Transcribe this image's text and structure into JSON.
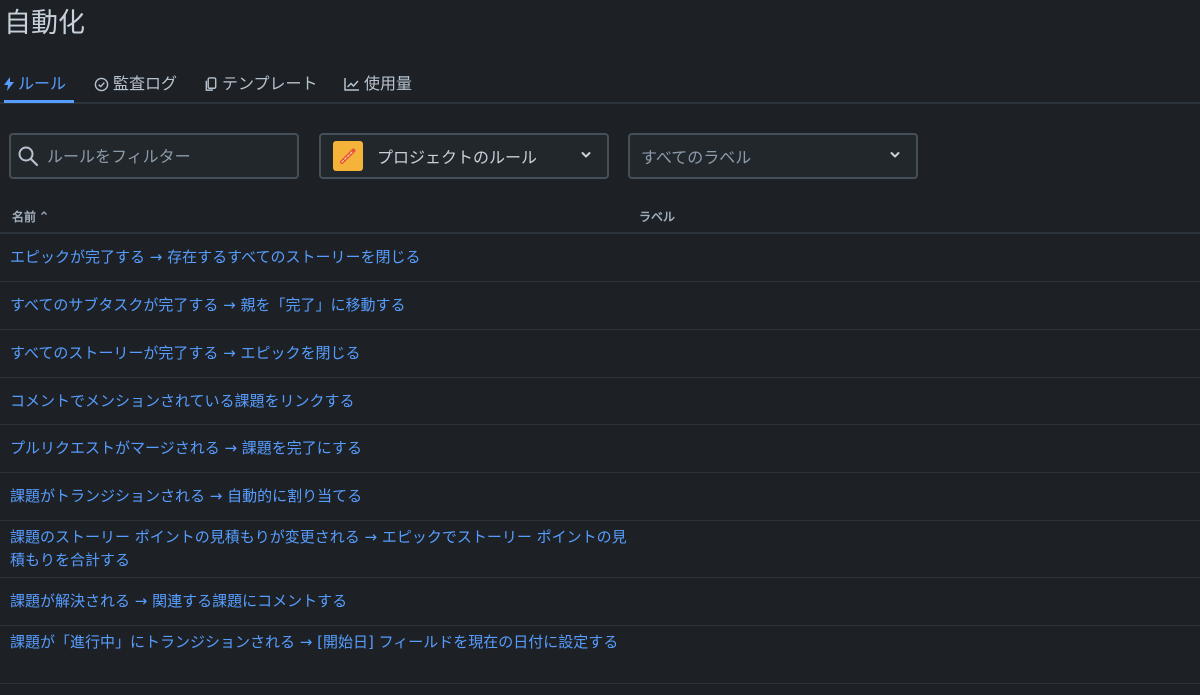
{
  "page": {
    "title": "自動化"
  },
  "tabs": [
    {
      "label": "ルール",
      "icon": "lightning-icon",
      "active": true
    },
    {
      "label": "監査ログ",
      "icon": "check-circle-icon",
      "active": false
    },
    {
      "label": "テンプレート",
      "icon": "copy-icon",
      "active": false
    },
    {
      "label": "使用量",
      "icon": "chart-icon",
      "active": false
    }
  ],
  "filters": {
    "search_placeholder": "ルールをフィルター",
    "project_select": "プロジェクトのルール",
    "label_select": "すべてのラベル"
  },
  "table": {
    "columns": {
      "name": "名前",
      "label": "ラベル"
    },
    "rows": [
      "エピックが完了する → 存在するすべてのストーリーを閉じる",
      "すべてのサブタスクが完了する → 親を「完了」に移動する",
      "すべてのストーリーが完了する → エピックを閉じる",
      "コメントでメンションされている課題をリンクする",
      "プルリクエストがマージされる → 課題を完了にする",
      "課題がトランジションされる → 自動的に割り当てる",
      "課題のストーリー ポイントの見積もりが変更される → エピックでストーリー ポイントの見積もりを合計する",
      "課題が解決される → 関連する課題にコメントする",
      "課題が「進行中」にトランジションされる → [開始日] フィールドを現在の日付に設定する"
    ]
  },
  "colors": {
    "background": "#1d2125",
    "link": "#579dff",
    "project_avatar": "#f5b33a"
  }
}
